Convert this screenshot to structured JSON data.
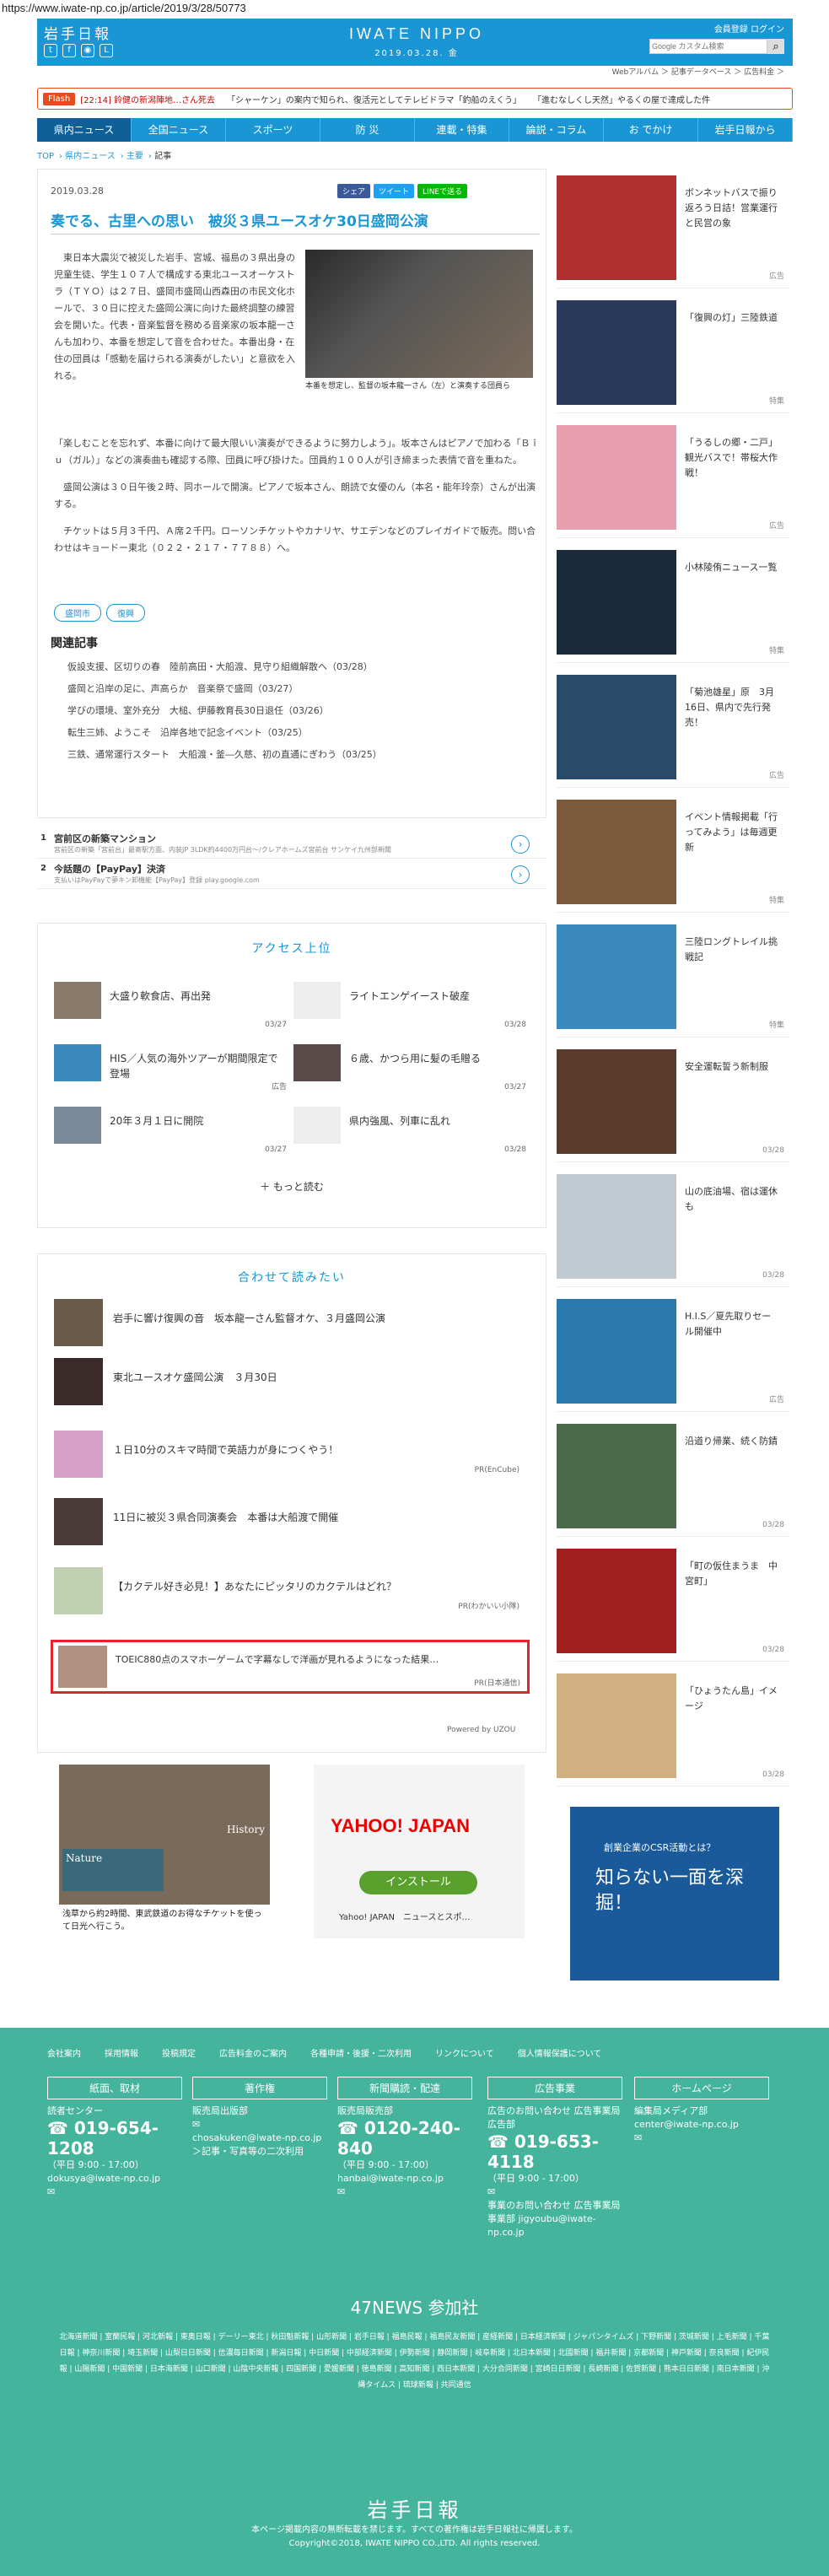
{
  "url": "https://www.iwate-np.co.jp/article/2019/3/28/50773",
  "header": {
    "logo_jp": "岩手日報",
    "logo_en": "IWATE NIPPO",
    "date": "2019.03.28. 金",
    "member_links": "会員登録 ログイン",
    "search_placeholder": "Google カスタム検索"
  },
  "subnav": "Webアルバム ＞ 記事データベース ＞ 広告料金 ＞",
  "flash": {
    "tag": "Flash",
    "items": [
      "[22:14] 鈴健の新潟陣地…さん死去",
      "「シャーケン」の案内で知られ、復活元としてテレビドラマ「釣船のえくう」",
      "「進むなしくし天然」やるくの屋で達成した件"
    ]
  },
  "nav": [
    "県内ニュース",
    "全国ニュース",
    "スポーツ",
    "防 災",
    "連載・特集",
    "論説・コラム",
    "お でかけ",
    "岩手日報から"
  ],
  "crumbs": [
    "TOP",
    "県内ニュース",
    "主要",
    "記事"
  ],
  "article": {
    "date": "2019.03.28",
    "share": [
      "シェア",
      "ツイート",
      "LINEで送る"
    ],
    "title": "奏でる、古里への思い　被災３県ユースオケ30日盛岡公演",
    "body1": "　東日本大震災で被災した岩手、宮城、福島の３県出身の児童生徒、学生１０７人で構成する東北ユースオーケストラ（ＴＹＯ）は２７日、盛岡市盛岡山西森田の市民文化ホールで、３０日に控えた盛岡公演に向けた最終調整の練習会を開いた。代表・音楽監督を務める音楽家の坂本龍一さんも加わり、本番を想定して音を合わせた。本番出身・在住の団員は「感動を届けられる演奏がしたい」と意欲を入れる。",
    "caption": "本番を想定し、監督の坂本龍一さん（左）と演奏する団員ら",
    "body2": [
      "「楽しむことを忘れず、本番に向けて最大限いい演奏ができるように努力しよう」。坂本さんはピアノで加わる「Ｂｉｕ（ガル）」などの演奏曲も確認する際、団員に呼び掛けた。団員約１００人が引き締まった表情で音を重ねた。",
      "　盛岡公演は３０日午後２時、同ホールで開演。ピアノで坂本さん、朗読で女優のん（本名・能年玲奈）さんが出演する。",
      "　チケットは５月３千円、Ａ席２千円。ローソンチケットやカナリヤ、サエデンなどのプレイガイドで販売。問い合わせはキョードー東北（０２２・２１７・７７８８）へ。"
    ],
    "tags": [
      "盛岡市",
      "復興"
    ],
    "related_heading": "関連記事",
    "related": [
      "仮設支援、区切りの春　陸前高田・大船渡、見守り組織解散へ（03/28）",
      "盛岡と沿岸の足に、声高らか　音楽祭で盛岡（03/27）",
      "学びの環境、室外充分　大槌、伊藤教育長30日退任（03/26）",
      "転生三姉、ようこそ　沿岸各地で記念イベント（03/25）",
      "三鉄、通常運行スタート　大船渡・釜―久慈、初の直通にぎわう（03/25）"
    ]
  },
  "ads": [
    {
      "n": "1",
      "t": "宮前区の新築マンション",
      "s": "宮前区の新築「宮前台」最寄駅方面、内装JP 3LDK約4400万円台～/クレアホームズ宮前台 サンケイ九州部新聞"
    },
    {
      "n": "2",
      "t": "今話題の【PayPay】決済",
      "s": "支払いはPayPayで夢キン卸機能【PayPay】登録 play.google.com"
    }
  ],
  "access": {
    "heading": "アクセス上位",
    "items": [
      {
        "text": "大盛り軟食店、再出発",
        "date": "03/27"
      },
      {
        "text": "ライトエンゲイースト破産",
        "date": "03/28"
      },
      {
        "text": "HIS／人気の海外ツアーが期間限定で登場",
        "date": "広告"
      },
      {
        "text": "６歳、かつら用に髪の毛贈る",
        "date": "03/27"
      },
      {
        "text": "20年３月１日に開院",
        "date": "03/27"
      },
      {
        "text": "県内強風、列車に乱れ",
        "date": "03/28"
      }
    ],
    "more": "もっと読む"
  },
  "recommend": {
    "heading": "合わせて読みたい",
    "items": [
      {
        "text": "岩手に響け復興の音　坂本龍一さん監督オケ、３月盛岡公演",
        "pr": ""
      },
      {
        "text": "東北ユースオケ盛岡公演　３月30日",
        "pr": ""
      },
      {
        "text": "１日10分のスキマ時間で英語力が身につくやう！",
        "pr": "PR(EnCube)"
      },
      {
        "text": "11日に被災３県合同演奏会　本番は大船渡で開催",
        "pr": ""
      },
      {
        "text": "【カクテル好き必見！】あなたにピッタリのカクテルはどれ？",
        "pr": "PR(わかいい小隊)"
      },
      {
        "text": "TOEIC880点のスマホーゲームで字幕なしで洋画が見れるようになった結果…",
        "pr": "PR(日本通信)"
      }
    ],
    "powered": "Powered by UZOU"
  },
  "bottom_ads": {
    "history": "History",
    "nature": "Nature",
    "hist_txt": "浅草から約2時間、東武鉄道のお得なチケットを使って日光へ行こう。",
    "yahoo": "YAHOO! JAPAN",
    "install": "インストール",
    "yahoo_sub": "Yahoo! JAPAN　ニュースとスポ…",
    "csr": "創業企業のCSR活動とは？",
    "csr_big": "知らない一面を深掘！"
  },
  "sidebar": [
    {
      "text": "ボンネットバスで振り返ろう日詰！営業運行と民営の象",
      "badge": "広告",
      "c": "#b03030"
    },
    {
      "text": "「復興の灯」三陸鉄道",
      "badge": "特集",
      "c": "#2a3a5a"
    },
    {
      "text": "「うるしの郷・二戸」観光バスで！帯桜大作戦！",
      "badge": "広告",
      "c": "#e8a0b0"
    },
    {
      "text": "小林陵侑ニュース一覧",
      "badge": "特集",
      "c": "#1a2a3a"
    },
    {
      "text": "「菊池雄星」原　3月16日、県内で先行発売！",
      "badge": "広告",
      "c": "#2a4a6a"
    },
    {
      "text": "イベント情報掲載「行ってみよう」は毎週更新",
      "badge": "特集",
      "c": "#7a5a3a"
    },
    {
      "text": "三陸ロングトレイル挑戦記",
      "badge": "特集",
      "c": "#3a8ac0"
    },
    {
      "text": "安全運転誓う新制服",
      "badge": "03/28",
      "c": "#5a3a2a"
    },
    {
      "text": "山の底油場、宿は運休も",
      "badge": "03/28",
      "c": "#c0c8d0"
    },
    {
      "text": "H.I.S／夏先取りセール開催中",
      "badge": "広告",
      "c": "#2a7ab0"
    },
    {
      "text": "沿道り帰業、続く防錆",
      "badge": "03/28",
      "c": "#4a6a4a"
    },
    {
      "text": "「町の仮住まうま　中宮町」",
      "badge": "03/28",
      "c": "#a02020"
    },
    {
      "text": "「ひょうたん島」イメージ",
      "badge": "03/28",
      "c": "#d0b080"
    }
  ],
  "footer": {
    "links": [
      "会社案内",
      "採用情報",
      "投稿規定",
      "広告料金のご案内",
      "各種申請・後援・二次利用",
      "リンクについて",
      "個人情報保護について"
    ],
    "boxes": [
      {
        "h": "紙面、取材",
        "l1": "読者センター",
        "ph": "019-654-1208",
        "l2": "（平日 9:00 - 17:00）",
        "l3": "dokusya@iwate-np.co.jp"
      },
      {
        "h": "著作権",
        "l1": "販売局出版部",
        "ph": "",
        "l2": "chosakuken@iwate-np.co.jp",
        "l3": "＞記事・写真等の二次利用"
      },
      {
        "h": "新聞購読・配達",
        "l1": "販売局販売部",
        "ph": "0120-240-840",
        "l2": "（平日 9:00 - 17:00）",
        "l3": "hanbai@iwate-np.co.jp"
      },
      {
        "h": "広告事業",
        "l1": "広告のお問い合わせ 広告事業局広告部",
        "ph": "019-653-4118",
        "l2": "（平日 9:00 - 17:00）",
        "l3": "事業のお問い合わせ 広告事業局事業部 jigyoubu@iwate-np.co.jp"
      },
      {
        "h": "ホームページ",
        "l1": "編集局メディア部",
        "ph": "",
        "l2": "center@iwate-np.co.jp",
        "l3": ""
      }
    ],
    "n47": "47NEWS 参加社",
    "n47_list": "北海道新聞 | 室蘭民報 | 河北新報 | 東奥日報 | デーリー東北 | 秋田魁新報 | 山形新聞 | 岩手日報 | 福島民報 | 福島民友新聞 | 産経新聞 | 日本経済新聞 | ジャパンタイムズ | 下野新聞 | 茨城新聞 | 上毛新聞 | 千葉日報 | 神奈川新聞 | 埼玉新聞 | 山梨日日新聞 | 信濃毎日新聞 | 新潟日報 | 中日新聞 | 中部経済新聞 | 伊勢新聞 | 静岡新聞 | 岐阜新聞 | 北日本新聞 | 北國新聞 | 福井新聞 | 京都新聞 | 神戸新聞 | 奈良新聞 | 紀伊民報 | 山陽新聞 | 中国新聞 | 日本海新聞 | 山口新聞 | 山陰中央新報 | 四国新聞 | 愛媛新聞 | 徳島新聞 | 高知新聞 | 西日本新聞 | 大分合同新聞 | 宮崎日日新聞 | 長崎新聞 | 佐賀新聞 | 熊本日日新聞 | 南日本新聞 | 沖縄タイムス | 琉球新報 | 共同通信",
    "logo": "岩手日報",
    "copy1": "本ページ掲載内容の無断転載を禁じます。すべての著作権は岩手日報社に帰属します。",
    "copy2": "Copyright©2018, IWATE NIPPO CO.,LTD. All rights reserved."
  }
}
